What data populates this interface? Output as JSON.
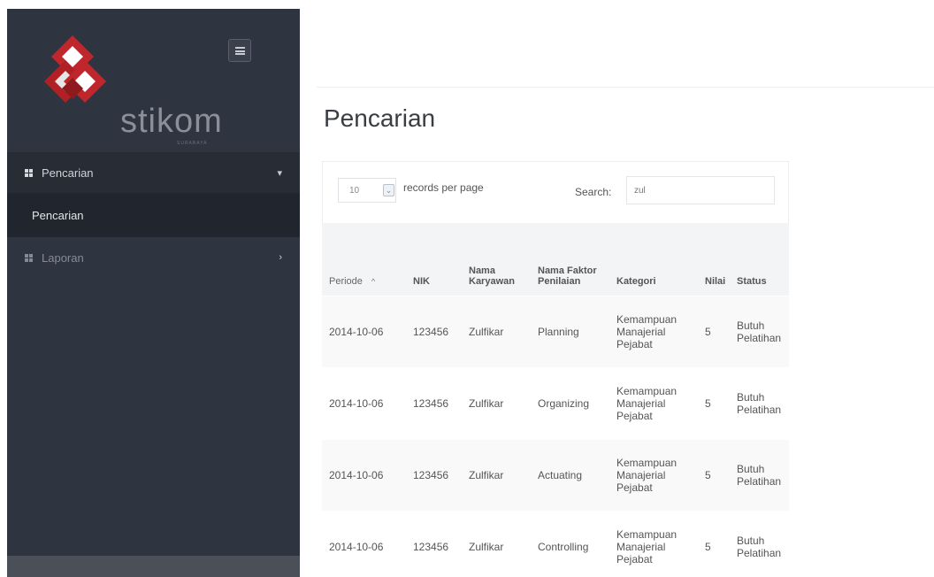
{
  "sidebar": {
    "logo_text": "stikom",
    "logo_sub": "SURABAYA",
    "menu": [
      {
        "label": "Pencarian",
        "icon": "grid-icon",
        "chevron": "chevron-down-icon"
      },
      {
        "label": "Pencarian"
      },
      {
        "label": "Laporan",
        "icon": "grid-icon",
        "chevron": "chevron-right-icon"
      }
    ]
  },
  "page": {
    "title": "Pencarian"
  },
  "datatable": {
    "page_length": "10",
    "records_per_page_label": "records per page",
    "search_label": "Search:",
    "search_value": "zul",
    "columns": [
      "Periode",
      "NIK",
      "Nama Karyawan",
      "Nama Faktor Penilaian",
      "Kategori",
      "Nilai",
      "Status"
    ],
    "sort_indicator": "^",
    "rows": [
      [
        "2014-10-06",
        "123456",
        "Zulfikar",
        "Planning",
        "Kemampuan Manajerial Pejabat",
        "5",
        "Butuh Pelatihan"
      ],
      [
        "2014-10-06",
        "123456",
        "Zulfikar",
        "Organizing",
        "Kemampuan Manajerial Pejabat",
        "5",
        "Butuh Pelatihan"
      ],
      [
        "2014-10-06",
        "123456",
        "Zulfikar",
        "Actuating",
        "Kemampuan Manajerial Pejabat",
        "5",
        "Butuh Pelatihan"
      ],
      [
        "2014-10-06",
        "123456",
        "Zulfikar",
        "Controlling",
        "Kemampuan Manajerial Pejabat",
        "5",
        "Butuh Pelatihan"
      ]
    ]
  },
  "colors": {
    "sidebar_bg": "#2f3540",
    "sidebar_active_bg": "#272c35",
    "sidebar_sub_bg": "#21252d",
    "logo_red": "#c0272d"
  }
}
